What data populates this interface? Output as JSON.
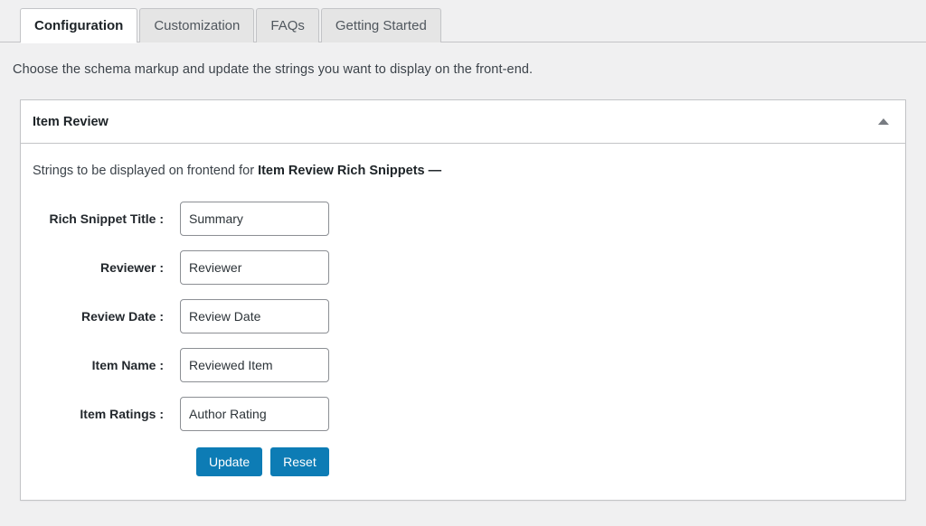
{
  "tabs": [
    {
      "label": "Configuration",
      "active": true
    },
    {
      "label": "Customization",
      "active": false
    },
    {
      "label": "FAQs",
      "active": false
    },
    {
      "label": "Getting Started",
      "active": false
    }
  ],
  "intro": "Choose the schema markup and update the strings you want to display on the front-end.",
  "panel": {
    "title": "Item Review",
    "toggle_icon": "caret-up-icon",
    "subtitle_prefix": "Strings to be displayed on frontend for ",
    "subtitle_strong": "Item Review Rich Snippets —",
    "fields": [
      {
        "label": "Rich Snippet Title :",
        "value": "Summary",
        "placeholder": "Summary"
      },
      {
        "label": "Reviewer :",
        "value": "Reviewer",
        "placeholder": "Reviewer"
      },
      {
        "label": "Review Date :",
        "value": "Review Date",
        "placeholder": "Review Date"
      },
      {
        "label": "Item Name :",
        "value": "Reviewed Item",
        "placeholder": "Reviewed Item"
      },
      {
        "label": "Item Ratings :",
        "value": "Author Rating",
        "placeholder": "Author Rating"
      }
    ],
    "buttons": {
      "update": "Update",
      "reset": "Reset"
    }
  },
  "colors": {
    "accent": "#0d7cb5",
    "page_bg": "#f0f0f1",
    "panel_border": "#c3c4c7",
    "tab_inactive_bg": "#e5e5e5",
    "input_border": "#8c8f94"
  }
}
